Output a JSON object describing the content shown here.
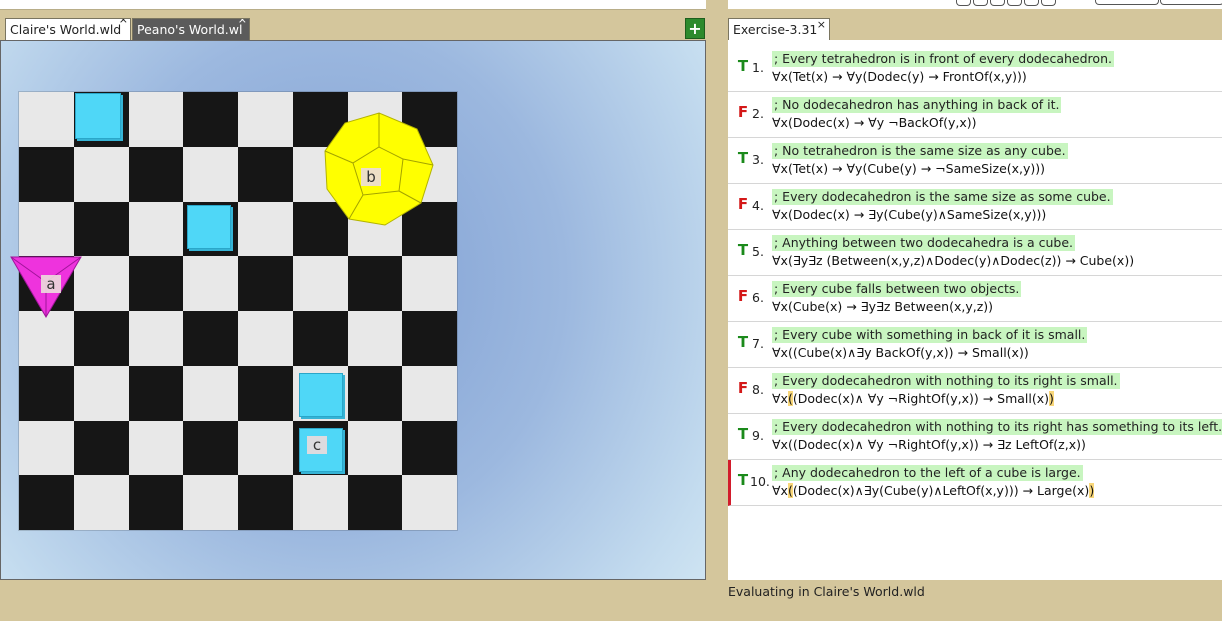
{
  "world_tabs": [
    {
      "label": "Claire's World.wld",
      "active": true
    },
    {
      "label": "Peano's World.wl",
      "active": false
    }
  ],
  "close_glyph": "×",
  "add_glyph": "+",
  "objects": {
    "a": "a",
    "b": "b",
    "c": "c"
  },
  "exercise_tab": "Exercise-3.31",
  "sentences": [
    {
      "num": "1.",
      "verdict": "T",
      "comment": "; Every tetrahedron is in front of every dodecahedron.",
      "formula": "∀x(Tet(x) → ∀y(Dodec(y) → FrontOf(x,y)))"
    },
    {
      "num": "2.",
      "verdict": "F",
      "comment": "; No dodecahedron has anything in back of it.",
      "formula": "∀x(Dodec(x) → ∀y ¬BackOf(y,x))"
    },
    {
      "num": "3.",
      "verdict": "T",
      "comment": "; No tetrahedron is the same size as any cube.",
      "formula": "∀x(Tet(x) → ∀y(Cube(y) → ¬SameSize(x,y)))"
    },
    {
      "num": "4.",
      "verdict": "F",
      "comment": "; Every dodecahedron is the same size as some cube.",
      "formula": "∀x(Dodec(x) → ∃y(Cube(y)∧SameSize(x,y)))"
    },
    {
      "num": "5.",
      "verdict": "T",
      "comment": "; Anything between two dodecahedra is a cube.",
      "formula": "∀x(∃y∃z (Between(x,y,z)∧Dodec(y)∧Dodec(z)) → Cube(x))"
    },
    {
      "num": "6.",
      "verdict": "F",
      "comment": "; Every cube falls between two objects.",
      "formula": "∀x(Cube(x) → ∃y∃z Between(x,y,z))"
    },
    {
      "num": "7.",
      "verdict": "T",
      "comment": "; Every cube with something in back of it is small.",
      "formula": "∀x((Cube(x)∧∃y BackOf(y,x)) → Small(x))"
    },
    {
      "num": "8.",
      "verdict": "F",
      "comment": "; Every dodecahedron with nothing to its right is small.",
      "formula_pre": "∀x",
      "formula_open": "(",
      "formula_mid": "(Dodec(x)∧ ∀y ¬RightOf(y,x)) → Small(x)",
      "formula_close": ")"
    },
    {
      "num": "9.",
      "verdict": "T",
      "comment": "; Every dodecahedron with nothing to its right has something to its left.",
      "formula": "∀x((Dodec(x)∧ ∀y ¬RightOf(y,x)) → ∃z LeftOf(z,x))"
    },
    {
      "num": "10.",
      "verdict": "T",
      "comment": "; Any dodecahedron to the left of a cube is large.",
      "formula_pre": "∀x",
      "formula_open": "(",
      "formula_mid": "(Dodec(x)∧∃y(Cube(y)∧LeftOf(x,y))) → Large(x)",
      "formula_close": ")"
    }
  ],
  "status": "Evaluating in Claire's World.wld"
}
